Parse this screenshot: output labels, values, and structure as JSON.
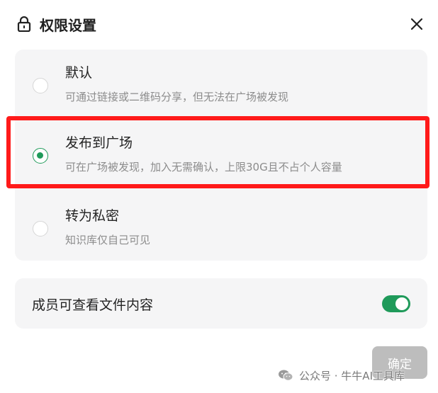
{
  "dialog": {
    "title": "权限设置",
    "close_icon": "close-icon"
  },
  "options": [
    {
      "title": "默认",
      "description": "可通过链接或二维码分享，但无法在广场被发现",
      "selected": false
    },
    {
      "title": "发布到广场",
      "description": "可在广场被发现，加入无需确认，上限30G且不占个人容量",
      "selected": true
    },
    {
      "title": "转为私密",
      "description": "知识库仅自己可见",
      "selected": false
    }
  ],
  "member_setting": {
    "label": "成员可查看文件内容",
    "enabled": true
  },
  "footer": {
    "confirm_label": "确定"
  },
  "watermark": {
    "text": "公众号 · 牛牛AI工具库"
  },
  "colors": {
    "accent": "#1f9a5a",
    "highlight": "#ff1a1a",
    "panel": "#f5f5f6"
  }
}
